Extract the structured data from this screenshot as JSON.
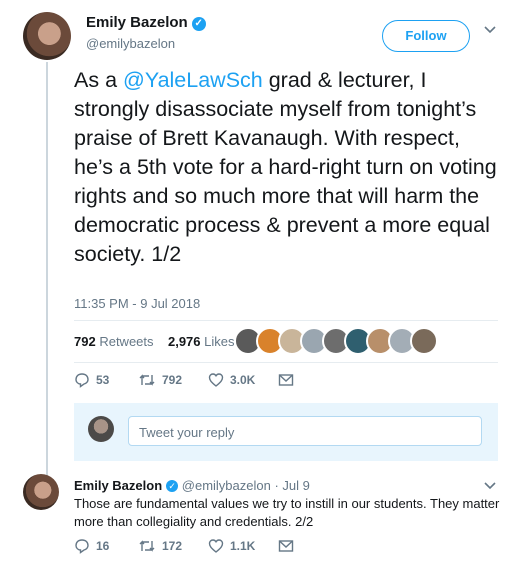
{
  "tweet": {
    "author_name": "Emily Bazelon",
    "author_handle": "@emilybazelon",
    "follow_label": "Follow",
    "text_before": "As a ",
    "mention": "@YaleLawSch",
    "text_after": " grad & lecturer, I strongly disassociate myself from tonight’s praise of Brett Kavanaugh. With respect, he’s a 5th vote for a hard-right turn on voting rights and so much more that will harm the democratic process & prevent a more equal society. 1/2",
    "timestamp": "11:35 PM - 9 Jul 2018",
    "retweets_count": "792",
    "retweets_label": "Retweets",
    "likes_count": "2,976",
    "likes_label": "Likes",
    "replies": "53",
    "retweets": "792",
    "likes": "3.0K"
  },
  "reply_box": {
    "placeholder": "Tweet your reply"
  },
  "reply_tweet": {
    "author_name": "Emily Bazelon",
    "author_handle": "@emilybazelon",
    "date": "· Jul 9",
    "text": "Those are fundamental values we try to instill in our students. They matter more than collegiality and credentials. 2/2",
    "replies": "16",
    "retweets": "172",
    "likes": "1.1K"
  },
  "colors": {
    "accent": "#1da1f2",
    "muted": "#657786",
    "reply_bg": "#e8f5fd"
  },
  "icons": [
    "verified-icon",
    "chevron-down-icon",
    "reply-icon",
    "retweet-icon",
    "like-icon",
    "dm-icon"
  ]
}
